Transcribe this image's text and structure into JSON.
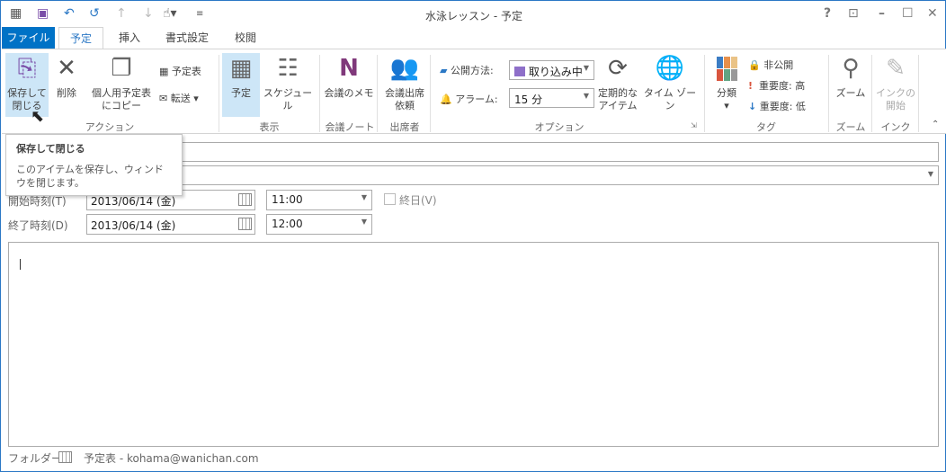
{
  "window": {
    "title": "水泳レッスン - 予定"
  },
  "tabs": [
    "ファイル",
    "予定",
    "挿入",
    "書式設定",
    "校閲"
  ],
  "ribbon": {
    "actions": {
      "save_close": "保存して\n閉じる",
      "delete": "削除",
      "copy_to_calendar": "個人用予定表\nにコピー",
      "calendar": "予定表",
      "forward": "転送",
      "group": "アクション"
    },
    "show": {
      "appointment": "予定",
      "schedule": "スケジュール",
      "group": "表示"
    },
    "notes": {
      "meeting_notes": "会議のメモ",
      "group": "会議ノート"
    },
    "attendees": {
      "invite": "会議出席\n依頼",
      "group": "出席者"
    },
    "options": {
      "show_as_label": "公開方法:",
      "show_as_value": "取り込み中",
      "reminder_label": "アラーム:",
      "reminder_value": "15 分",
      "recurrence": "定期的な\nアイテム",
      "time_zones": "タイム ゾーン",
      "group": "オプション"
    },
    "tags": {
      "categorize": "分類",
      "private": "非公開",
      "high": "重要度: 高",
      "low": "重要度: 低",
      "group": "タグ"
    },
    "zoom": {
      "zoom": "ズーム",
      "group": "ズーム"
    },
    "ink": {
      "start": "インクの\n開始",
      "group": "インク"
    }
  },
  "tooltip": {
    "title": "保存して閉じる",
    "body": "このアイテムを保存し、ウィンドウを閉じます。"
  },
  "form": {
    "start_label": "開始時刻(T)",
    "start_date": "2013/06/14 (金)",
    "start_time": "11:00",
    "all_day": "終日(V)",
    "end_label": "終了時刻(D)",
    "end_date": "2013/06/14 (金)",
    "end_time": "12:00"
  },
  "status": {
    "folder_label": "フォルダー",
    "folder_value": "予定表 - kohama@wanichan.com"
  },
  "colors": {
    "accent": "#0072c6",
    "busy": "#8e6fc9"
  }
}
